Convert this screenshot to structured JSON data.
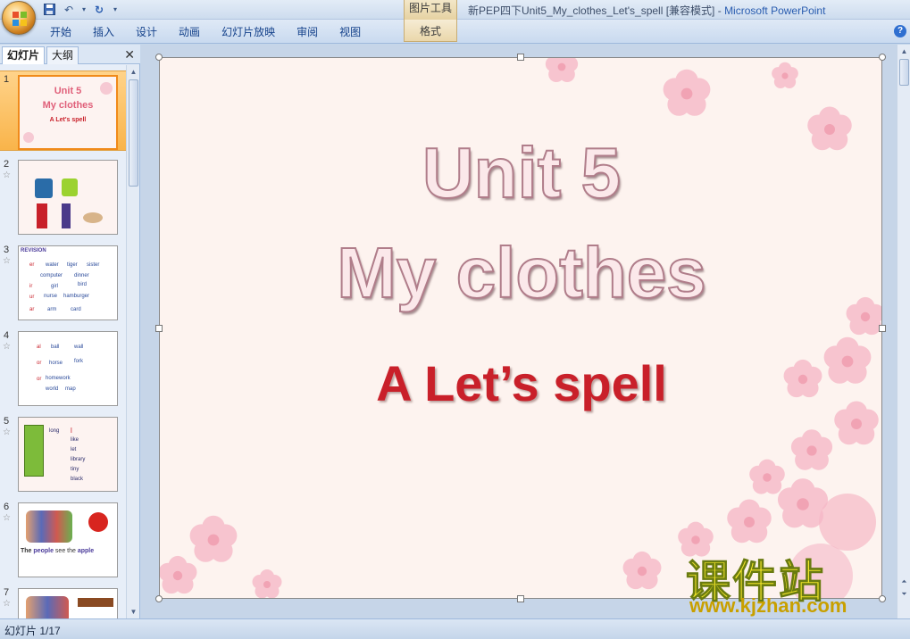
{
  "window": {
    "title_prefix": "新PEP四下Unit5_My_clothes_Let's_spell [兼容模式] - ",
    "app_name": "Microsoft PowerPoint",
    "context_group": "图片工具"
  },
  "ribbon": {
    "tabs": [
      "开始",
      "插入",
      "设计",
      "动画",
      "幻灯片放映",
      "审阅",
      "视图"
    ],
    "context_tab": "格式"
  },
  "left_pane": {
    "tab_slides": "幻灯片",
    "tab_outline": "大纲",
    "close": "✕",
    "thumbnails": [
      {
        "num": "1",
        "lines": [
          "Unit 5",
          "My clothes",
          "A Let's spell"
        ]
      },
      {
        "num": "2",
        "lines": []
      },
      {
        "num": "3",
        "lines": [
          "REVISION",
          "er",
          "water",
          "tiger",
          "sister",
          "computer",
          "dinner",
          "ir",
          "girl",
          "bird",
          "ur",
          "nurse",
          "hamburger",
          "ar",
          "arm",
          "card"
        ]
      },
      {
        "num": "4",
        "lines": [
          "al",
          "ball",
          "wall",
          "or",
          "horse",
          "fork",
          "or",
          "homework",
          "world",
          "map"
        ]
      },
      {
        "num": "5",
        "lines": [
          "long",
          "l",
          "like",
          "let",
          "library",
          "tiny",
          "black"
        ]
      },
      {
        "num": "6",
        "lines": [
          "The",
          "people",
          "see",
          "the",
          "apple"
        ]
      },
      {
        "num": "7",
        "lines": []
      }
    ]
  },
  "slide": {
    "title_line1": "Unit 5",
    "title_line2": "My clothes",
    "subtitle": "A Let’s spell"
  },
  "status": {
    "slide_info": "幻灯片 1/17"
  },
  "watermark": {
    "text": "课件站",
    "url": "www.kjzhan.com"
  },
  "colors": {
    "subtitle_red": "#c9202a",
    "selection_orange": "#f9b44a",
    "ribbon_text": "#15428b"
  }
}
